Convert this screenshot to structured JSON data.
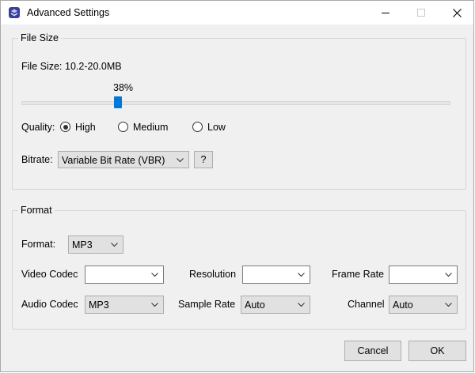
{
  "window": {
    "title": "Advanced Settings",
    "app_icon": "app-logo-icon"
  },
  "file_size": {
    "legend": "File Size",
    "size_label": "File Size:",
    "size_value": "10.2-20.0MB",
    "slider_percent_label": "38%",
    "slider_value": 0.22,
    "quality_label": "Quality:",
    "quality_options": [
      {
        "label": "High",
        "checked": true
      },
      {
        "label": "Medium",
        "checked": false
      },
      {
        "label": "Low",
        "checked": false
      }
    ],
    "bitrate_label": "Bitrate:",
    "bitrate_value": "Variable Bit Rate (VBR)",
    "help_label": "?"
  },
  "format": {
    "legend": "Format",
    "format_label": "Format:",
    "format_value": "MP3",
    "video_codec_label": "Video Codec",
    "video_codec_value": "",
    "resolution_label": "Resolution",
    "resolution_value": "",
    "frame_rate_label": "Frame Rate",
    "frame_rate_value": "",
    "audio_codec_label": "Audio Codec",
    "audio_codec_value": "MP3",
    "sample_rate_label": "Sample Rate",
    "sample_rate_value": "Auto",
    "channel_label": "Channel",
    "channel_value": "Auto"
  },
  "footer": {
    "cancel_label": "Cancel",
    "ok_label": "OK"
  },
  "colors": {
    "accent": "#0078d7",
    "background": "#f0f0f0",
    "button": "#e1e1e1"
  }
}
